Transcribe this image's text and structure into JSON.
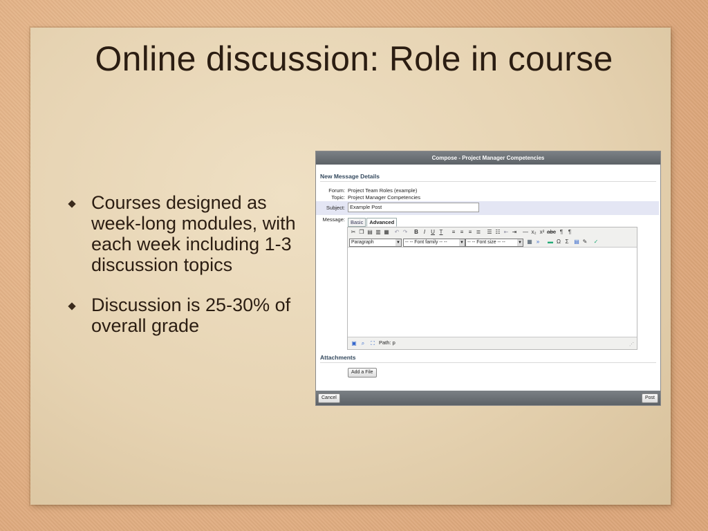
{
  "slide": {
    "title": "Online discussion: Role in course",
    "bullets": [
      "Courses designed as week-long modules, with each week including 1-3 discussion topics",
      "Discussion is 25-30% of overall grade"
    ]
  },
  "window": {
    "title": "Compose - Project Manager Competencies",
    "section_details": "New Message Details",
    "forum_label": "Forum:",
    "forum_value": "Project Team Roles (example)",
    "topic_label": "Topic:",
    "topic_value": "Project Manager Competencies",
    "subject_label": "Subject:",
    "subject_value": "Example Post",
    "message_label": "Message:",
    "tabs": [
      "Basic",
      "Advanced"
    ],
    "format_select": "Paragraph",
    "font_family_select": "-- -- Font family -- --",
    "font_size_select": "-- -- Font size -- --",
    "path_text": "Path: p",
    "section_attachments": "Attachments",
    "add_file_label": "Add a File",
    "cancel_label": "Cancel",
    "post_label": "Post"
  },
  "colors": {
    "title_bar": "#6b7075",
    "subject_row": "#e4e6f4",
    "section_heading": "#34495e"
  }
}
